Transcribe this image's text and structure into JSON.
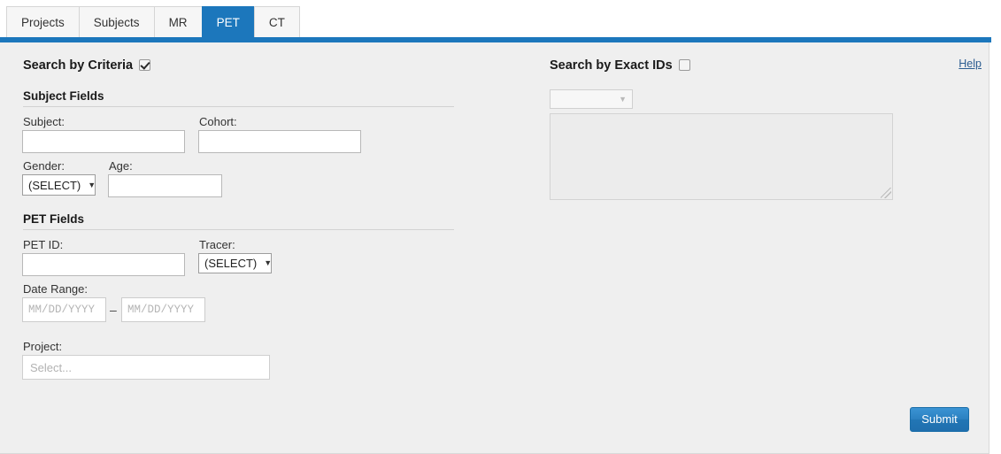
{
  "tabs": [
    {
      "label": "Projects",
      "active": false
    },
    {
      "label": "Subjects",
      "active": false
    },
    {
      "label": "MR",
      "active": false
    },
    {
      "label": "PET",
      "active": true
    },
    {
      "label": "CT",
      "active": false
    }
  ],
  "criteria": {
    "heading": "Search by Criteria",
    "checked": true,
    "subject_section": {
      "title": "Subject Fields",
      "subject_label": "Subject:",
      "subject_value": "",
      "cohort_label": "Cohort:",
      "cohort_value": "",
      "gender_label": "Gender:",
      "gender_value": "(SELECT)",
      "age_label": "Age:",
      "age_value": ""
    },
    "pet_section": {
      "title": "PET Fields",
      "petid_label": "PET ID:",
      "petid_value": "",
      "tracer_label": "Tracer:",
      "tracer_value": "(SELECT)",
      "daterange_label": "Date Range:",
      "date_from_placeholder": "MM/DD/YYYY",
      "date_from_value": "",
      "date_separator": "–",
      "date_to_placeholder": "MM/DD/YYYY",
      "date_to_value": "",
      "project_label": "Project:",
      "project_placeholder": "Select..."
    }
  },
  "exact": {
    "heading": "Search by Exact IDs",
    "checked": false,
    "select_value": "",
    "textarea_value": ""
  },
  "help": {
    "label": "Help"
  },
  "submit": {
    "label": "Submit"
  },
  "colors": {
    "accent": "#1c77bc",
    "panel_bg": "#efefef",
    "link": "#2c5d91"
  }
}
